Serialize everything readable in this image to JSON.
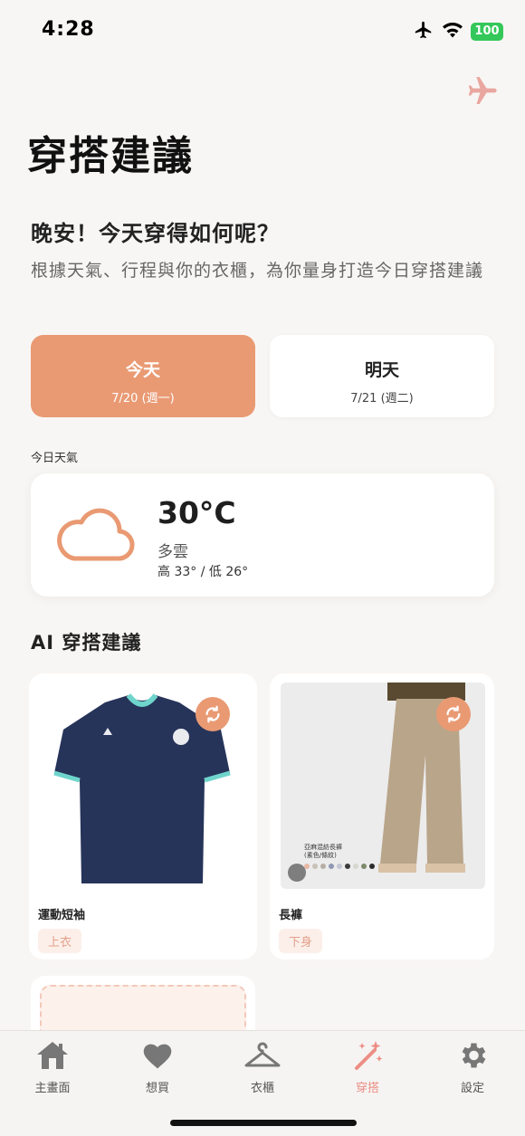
{
  "status_bar": {
    "time": "4:28",
    "battery": "100"
  },
  "header": {
    "title": "穿搭建議",
    "greeting": "晚安！今天穿得如何呢？",
    "subtitle": "根據天氣、行程與你的衣櫃，為你量身打造今日穿搭建議"
  },
  "day_tabs": [
    {
      "label": "今天",
      "date": "7/20 (週一)"
    },
    {
      "label": "明天",
      "date": "7/21 (週二)"
    }
  ],
  "weather": {
    "section_label": "今日天氣",
    "temp": "30°C",
    "condition": "多雲",
    "hilo": "高 33° / 低 26°",
    "icon": "cloud-icon"
  },
  "ai_section": {
    "title": "AI 穿搭建議"
  },
  "outfits": [
    {
      "name": "運動短袖",
      "tag": "上衣"
    },
    {
      "name": "長褲",
      "tag": "下身",
      "image_text_1": "亞麻混紡長褲",
      "image_text_2": "(素色/條紋)"
    }
  ],
  "tab_bar": [
    {
      "label": "主畫面",
      "icon": "home-icon"
    },
    {
      "label": "想買",
      "icon": "heart-icon"
    },
    {
      "label": "衣櫃",
      "icon": "hanger-icon"
    },
    {
      "label": "穿搭",
      "icon": "magic-wand-icon",
      "active": true
    },
    {
      "label": "設定",
      "icon": "gear-icon"
    }
  ],
  "colors": {
    "accent": "#e99a73",
    "active_tab": "#ec8e86",
    "background": "#f8f6f4"
  }
}
